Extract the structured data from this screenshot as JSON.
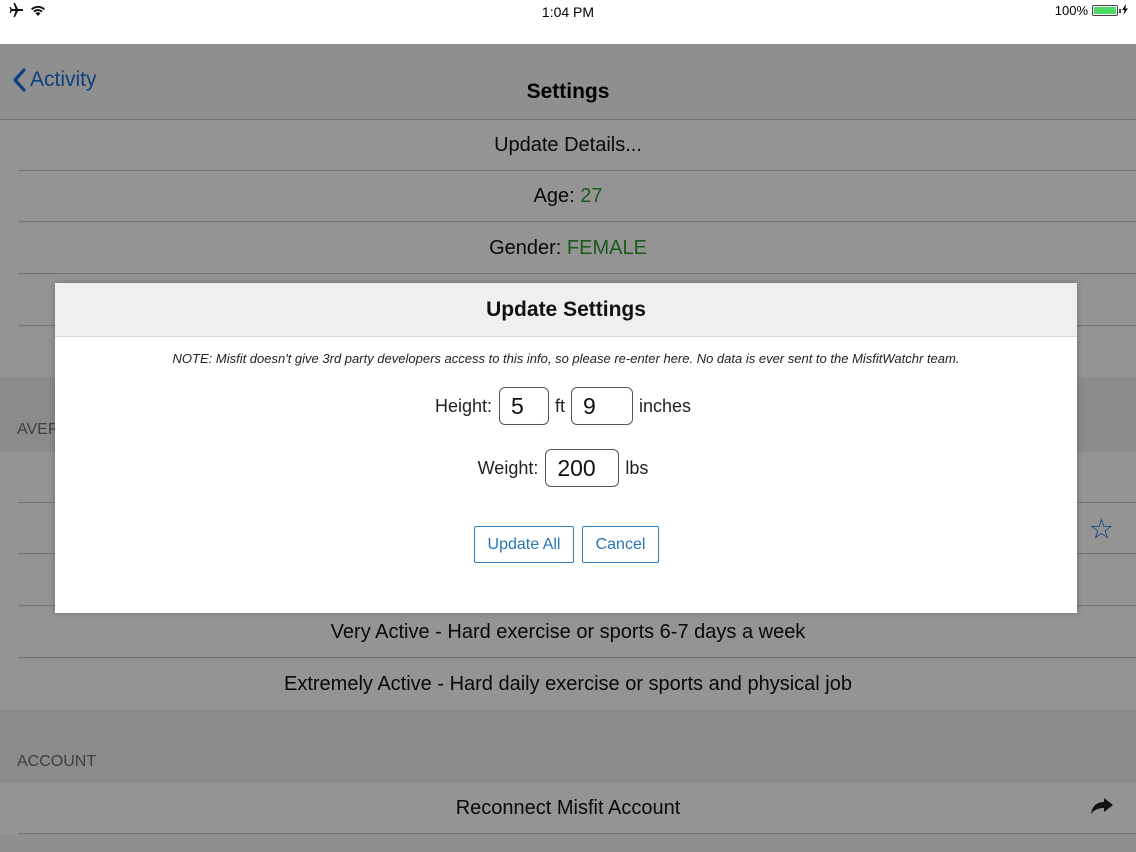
{
  "status_bar": {
    "time": "1:04 PM",
    "battery_text": "100%",
    "airplane_icon": "airplane-icon",
    "wifi_icon": "wifi-icon",
    "battery_level": 1.0
  },
  "navbar": {
    "back_label": "Activity",
    "title": "Settings"
  },
  "settings": {
    "update_details": "Update Details...",
    "age_label": "Age:",
    "age_value": "27",
    "gender_label": "Gender:",
    "gender_value": "FEMALE",
    "section_average_partial": "AVER",
    "activity_levels": [
      "Very Active - Hard exercise or sports 6-7 days a week",
      "Extremely Active - Hard daily exercise or sports and physical job"
    ],
    "account_header": "ACCOUNT",
    "reconnect_label": "Reconnect Misfit Account"
  },
  "modal": {
    "title": "Update Settings",
    "note": "NOTE: Misfit doesn't give 3rd party developers access to this info, so please re-enter here. No data is ever sent to the MisfitWatchr team.",
    "height_label": "Height:",
    "height_feet": "5",
    "feet_unit": "ft",
    "height_inches": "9",
    "inches_unit": "inches",
    "weight_label": "Weight:",
    "weight_value": "200",
    "weight_unit": "lbs",
    "update_button": "Update All",
    "cancel_button": "Cancel"
  },
  "colors": {
    "accent_blue": "#1a6fd8",
    "value_green": "#2e9b2e",
    "battery_green": "#4cd964"
  }
}
